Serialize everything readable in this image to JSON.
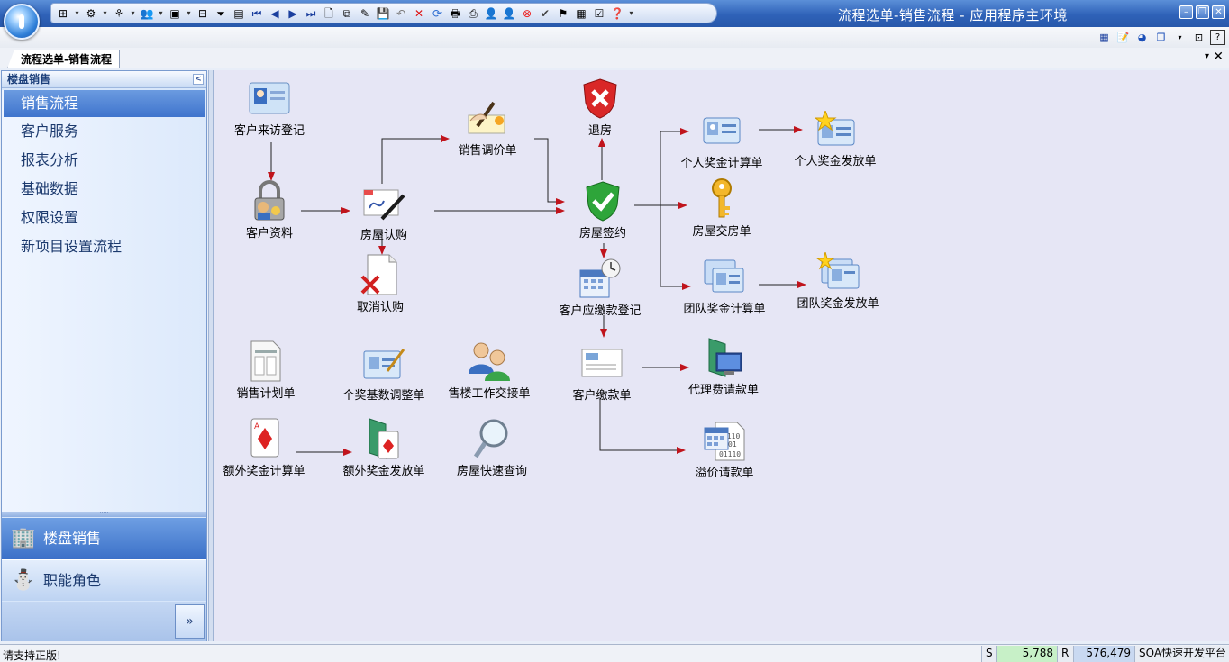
{
  "window": {
    "title": "流程选单-销售流程 - 应用程序主环境",
    "minimize_glyph": "–",
    "restore_glyph": "❐",
    "close_glyph": "✕"
  },
  "tab": {
    "label": "流程选单-销售流程",
    "menu_glyph": "▾",
    "close_glyph": "✕"
  },
  "sidebar": {
    "header": "楼盘销售",
    "collapse_glyph": "<",
    "items": [
      {
        "label": "销售流程",
        "active": true
      },
      {
        "label": "客户服务"
      },
      {
        "label": "报表分析"
      },
      {
        "label": "基础数据"
      },
      {
        "label": "权限设置"
      },
      {
        "label": "新项目设置流程"
      }
    ],
    "grip": "·····",
    "sections": [
      {
        "label": "楼盘销售",
        "icon": "building-icon"
      },
      {
        "label": "职能角色",
        "icon": "snowman-icon"
      }
    ],
    "expand_glyph": "»"
  },
  "flow": {
    "nodes": {
      "visit": "客户来访登记",
      "customer": "客户资料",
      "subscribe": "房屋认购",
      "cancel": "取消认购",
      "price_adjust": "销售调价单",
      "refund": "退房",
      "sign": "房屋签约",
      "payable": "客户应缴款登记",
      "payment": "客户缴款单",
      "personal_bonus_calc": "个人奖金计算单",
      "personal_bonus_pay": "个人奖金发放单",
      "handover": "房屋交房单",
      "team_bonus_calc": "团队奖金计算单",
      "team_bonus_pay": "团队奖金发放单",
      "agent_fee": "代理费请款单",
      "premium": "溢价请款单",
      "sales_plan": "销售计划单",
      "bonus_base": "个奖基数调整单",
      "handoff": "售楼工作交接单",
      "extra_bonus_calc": "额外奖金计算单",
      "extra_bonus_pay": "额外奖金发放单",
      "quick_query": "房屋快速查询"
    }
  },
  "status": {
    "message": "请支持正版!",
    "s_label": "S",
    "s_value": "5,788",
    "r_label": "R",
    "r_value": "576,479",
    "app_name": "SOA快速开发平台"
  },
  "colors": {
    "accent": "#3f74cd",
    "arrow": "#c0141c",
    "canvas": "#e6e6f5"
  }
}
